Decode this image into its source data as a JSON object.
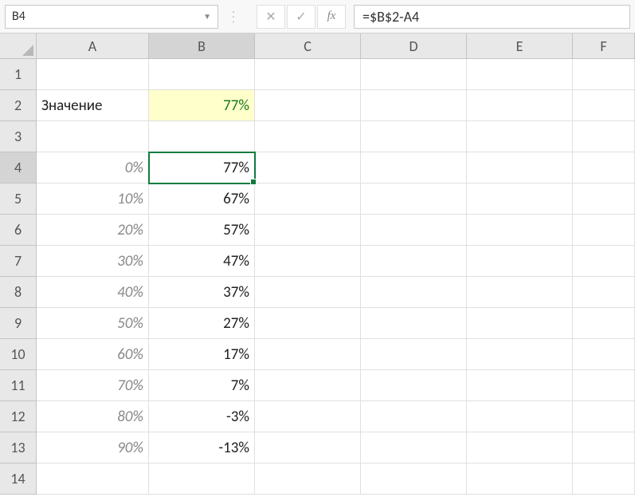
{
  "name_box": "B4",
  "formula": "=$B$2-A4",
  "col_headers": [
    "A",
    "B",
    "C",
    "D",
    "E",
    "F"
  ],
  "active_col_index": 1,
  "row_headers": [
    "1",
    "2",
    "3",
    "4",
    "5",
    "6",
    "7",
    "8",
    "9",
    "10",
    "11",
    "12",
    "13",
    "14"
  ],
  "active_row_index": 3,
  "cells": {
    "r2": {
      "A": "Значение",
      "B": "77%"
    },
    "r4": {
      "A": "0%",
      "B": "77%"
    },
    "r5": {
      "A": "10%",
      "B": "67%"
    },
    "r6": {
      "A": "20%",
      "B": "57%"
    },
    "r7": {
      "A": "30%",
      "B": "47%"
    },
    "r8": {
      "A": "40%",
      "B": "37%"
    },
    "r9": {
      "A": "50%",
      "B": "27%"
    },
    "r10": {
      "A": "60%",
      "B": "17%"
    },
    "r11": {
      "A": "70%",
      "B": "7%"
    },
    "r12": {
      "A": "80%",
      "B": "-3%"
    },
    "r13": {
      "A": "90%",
      "B": "-13%"
    }
  }
}
